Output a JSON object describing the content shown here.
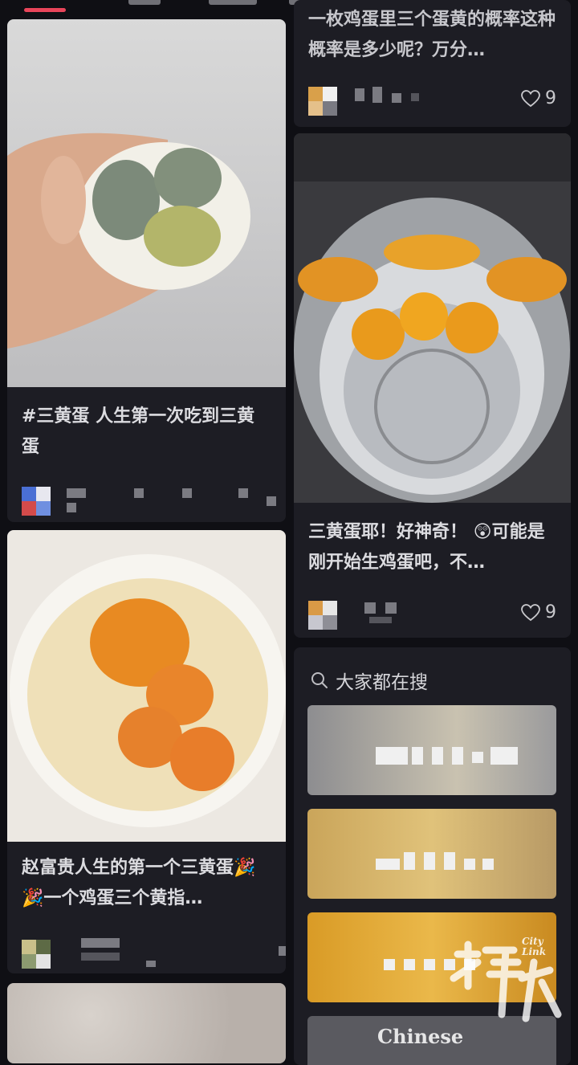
{
  "feed": {
    "left": {
      "cards": [
        {
          "title": "#三黄蛋 人生第一次吃到三黄蛋"
        },
        {
          "title": "赵富贵人生的第一个三黄蛋🎉🎉一个鸡蛋三个黄指…"
        }
      ]
    },
    "right": {
      "top_card": {
        "title": "一枚鸡蛋里三个蛋黄的概率这种概率是多少呢？万分…",
        "likes": "9"
      },
      "card2": {
        "title": "三黄蛋耶！好神奇！ 😲可能是刚开始生鸡蛋吧，不…",
        "likes": "9"
      }
    },
    "search": {
      "label": "大家都在搜",
      "icon": "search-icon"
    }
  },
  "watermark": {
    "brand": "Chinese",
    "city": "City Link"
  },
  "colors": {
    "accent": "#e9455a",
    "background": "#0f0f14",
    "card": "#1d1d24"
  }
}
